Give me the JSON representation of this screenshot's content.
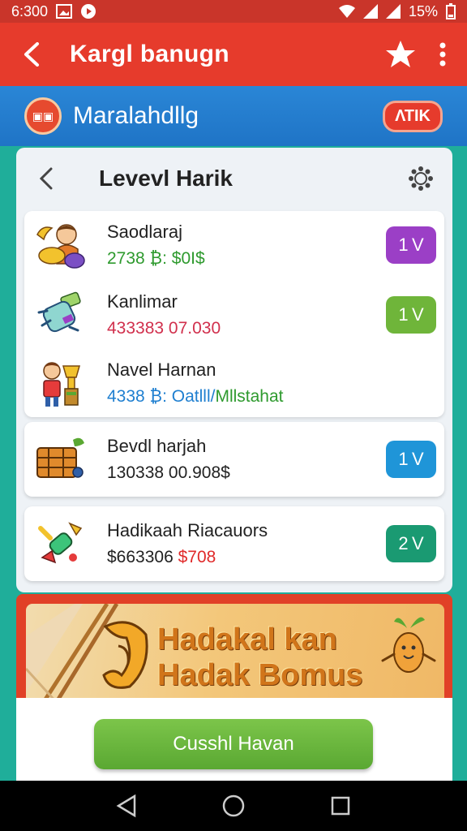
{
  "status_bar": {
    "time": "6:300",
    "battery": "15%"
  },
  "app_bar": {
    "title": "Kargl banugn"
  },
  "sub_banner": {
    "title": "Maralahdllg",
    "logo_text": "▣▣",
    "badge": "ΛΤΙΚ"
  },
  "card": {
    "title": "Levevl Harik",
    "items": [
      {
        "name": "Saodlaraj",
        "sub": "2738 ₿: $0I$",
        "sub_color": "#2e9a2e",
        "level": "1 V",
        "btn_color": "#9b3fc6",
        "icon": "character-with-bananas-icon"
      },
      {
        "name": "Kanlimar",
        "sub": "433383 07.030",
        "sub_color": "#d1304d",
        "level": "1 V",
        "btn_color": "#6fb53a",
        "icon": "potion-bottle-icon"
      },
      {
        "name": "Navel Harnan",
        "sub_a": "4338 ₿: ",
        "sub_b": "Oatlll/",
        "sub_c": "Mllstahat",
        "sub_color_a": "#1f7fd0",
        "sub_color_b": "#1f7fd0",
        "sub_color_c": "#2e9a2e",
        "icon": "girl-with-trophy-icon"
      }
    ],
    "solo_items": [
      {
        "name": "Bevdl harjah",
        "sub": "130338 00.908$",
        "sub_color": "#222222",
        "level": "1 V",
        "btn_color": "#1f95d8",
        "icon": "treasure-chest-icon"
      },
      {
        "name": "Hadikaah Riacauors",
        "sub_a": "$663306 ",
        "sub_b": "$708",
        "sub_color_a": "#222222",
        "sub_color_b": "#e02a2a",
        "level": "2 V",
        "btn_color": "#1a9a72",
        "icon": "magic-wand-icon"
      }
    ]
  },
  "promo": {
    "line1": "Hadakal kan",
    "line2": "Hadak Bomus"
  },
  "cta": {
    "label": "Cusshl Havan"
  },
  "colors": {
    "app_bar": "#e63b2c",
    "banner": "#2a86d6",
    "background": "#1fae9a"
  }
}
